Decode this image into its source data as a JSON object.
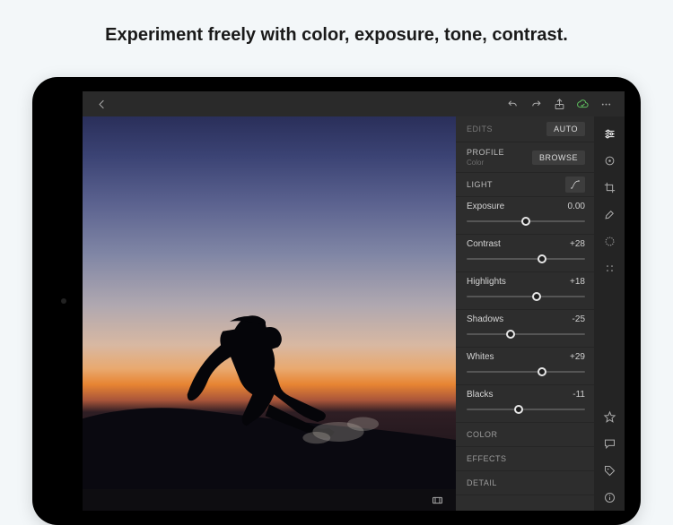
{
  "headline": "Experiment freely with color, exposure, tone, contrast.",
  "panel": {
    "edits_label": "EDITS",
    "auto_label": "AUTO",
    "profile_label": "PROFILE",
    "profile_value": "Color",
    "browse_label": "BROWSE",
    "light_section": "LIGHT",
    "color_section": "COLOR",
    "effects_section": "EFFECTS",
    "detail_section": "DETAIL"
  },
  "sliders": [
    {
      "name": "Exposure",
      "value": "0.00",
      "pos": 50
    },
    {
      "name": "Contrast",
      "value": "+28",
      "pos": 64
    },
    {
      "name": "Highlights",
      "value": "+18",
      "pos": 59
    },
    {
      "name": "Shadows",
      "value": "-25",
      "pos": 37
    },
    {
      "name": "Whites",
      "value": "+29",
      "pos": 64
    },
    {
      "name": "Blacks",
      "value": "-11",
      "pos": 44
    }
  ]
}
